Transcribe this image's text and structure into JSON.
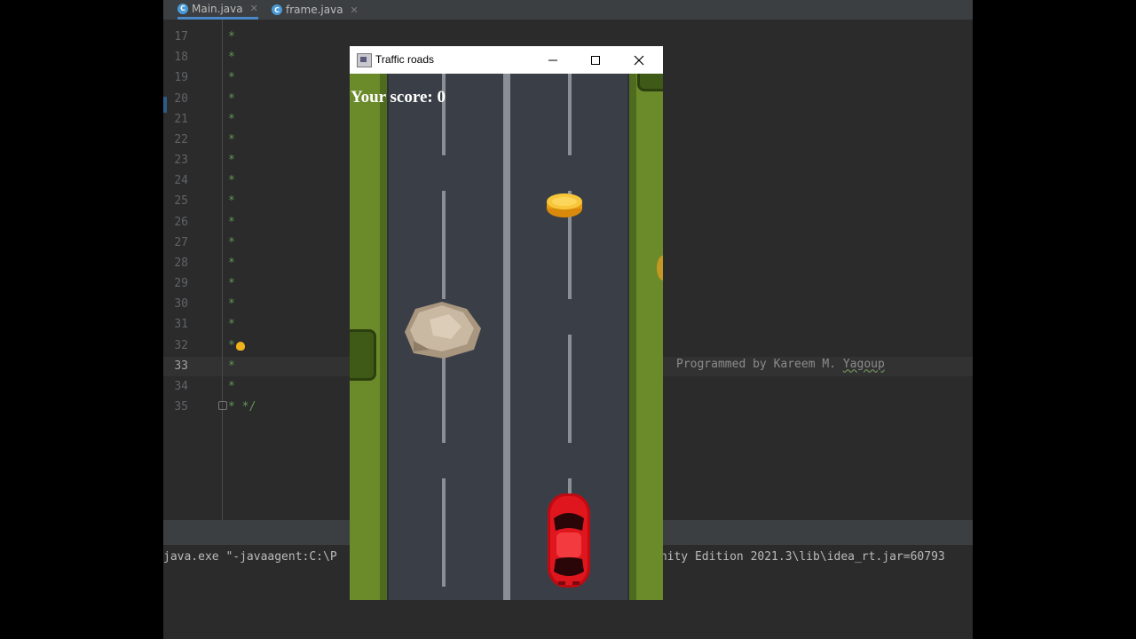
{
  "ide": {
    "tabs": [
      {
        "label": "Main.java",
        "icon": "C"
      },
      {
        "label": "frame.java",
        "icon": "C"
      }
    ],
    "line_numbers": [
      "17",
      "18",
      "19",
      "20",
      "21",
      "22",
      "23",
      "24",
      "25",
      "26",
      "27",
      "28",
      "29",
      "30",
      "31",
      "32",
      "33",
      "34",
      "35"
    ],
    "current_line": "33",
    "comment_star": "*",
    "last_line_text": "* */",
    "comment_text_prefix": "Programmed by Kareem M. ",
    "comment_text_name": "Yagoup",
    "console_left": "java.exe \"-javaagent:C:\\P",
    "console_right": "unity Edition 2021.3\\lib\\idea_rt.jar=60793"
  },
  "window": {
    "title": "Traffic roads",
    "minimize_glyph": "─",
    "maximize_glyph": "☐",
    "close_glyph": "✕"
  },
  "game": {
    "score_label": "Your score: 0"
  },
  "colors": {
    "grass": "#6b8a2a",
    "road": "#3a3f47",
    "lane_marking": "#8a8f96",
    "car": "#d9141a",
    "coin": "#f5b21c",
    "rock": "#c9b8a2"
  }
}
